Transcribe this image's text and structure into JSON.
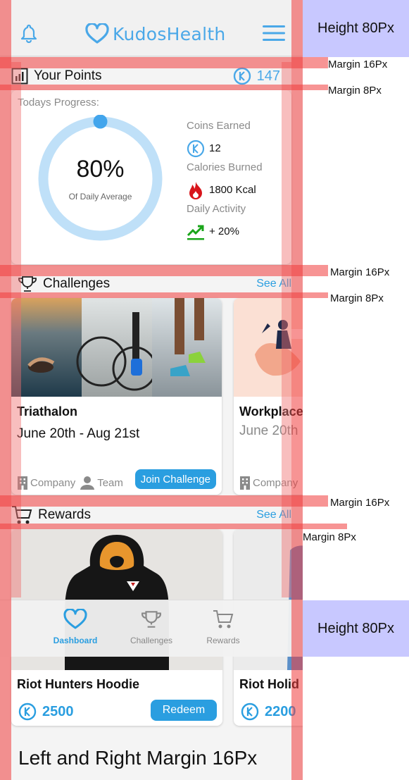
{
  "app": {
    "name": "KudosHealth"
  },
  "points_section": {
    "title": "Your Points",
    "value": "147"
  },
  "progress": {
    "label": "Todays Progress:",
    "percent_text": "80%",
    "percent_value": 0.8,
    "subtitle": "Of Daily Average",
    "coins_label": "Coins Earned",
    "coins_value": "12",
    "calories_label": "Calories Burned",
    "calories_value": "1800 Kcal",
    "activity_label": "Daily Activity",
    "activity_value": "+ 20%"
  },
  "challenges": {
    "title": "Challenges",
    "see_all": "See All",
    "cards": [
      {
        "title": "Triathalon",
        "date": "June 20th - Aug 21st",
        "tag_company": "Company",
        "tag_team": "Team",
        "button": "Join Challenge"
      },
      {
        "title": "Workplace",
        "date": "June 20th",
        "tag_company": "Company"
      }
    ]
  },
  "rewards": {
    "title": "Rewards",
    "see_all": "See All",
    "cards": [
      {
        "title": "Riot Hunters Hoodie",
        "price": "2500",
        "button": "Redeem"
      },
      {
        "title": "Riot Holid",
        "price": "2200"
      }
    ]
  },
  "bottom_nav": {
    "items": [
      {
        "label": "Dashboard",
        "icon": "heart-icon",
        "active": true
      },
      {
        "label": "Challenges",
        "icon": "trophy-icon",
        "active": false
      },
      {
        "label": "Rewards",
        "icon": "cart-icon",
        "active": false
      }
    ]
  },
  "annotations": {
    "top_height": "Height 80Px",
    "bottom_height": "Height 80Px",
    "margin16_a": "Margin 16Px",
    "margin8_a": "Margin 8Px",
    "margin16_b": "Margin 16Px",
    "margin8_b": "Margin 8Px",
    "margin16_c": "Margin 16Px",
    "margin8_c": "Margin 8Px",
    "side_margins": "Left and Right Margin 16Px"
  },
  "colors": {
    "accent": "#2a9ee0",
    "logo": "#4aa8e8",
    "ring": "#bfe0f8",
    "flame": "#d8151b",
    "trend": "#1aa51a"
  }
}
